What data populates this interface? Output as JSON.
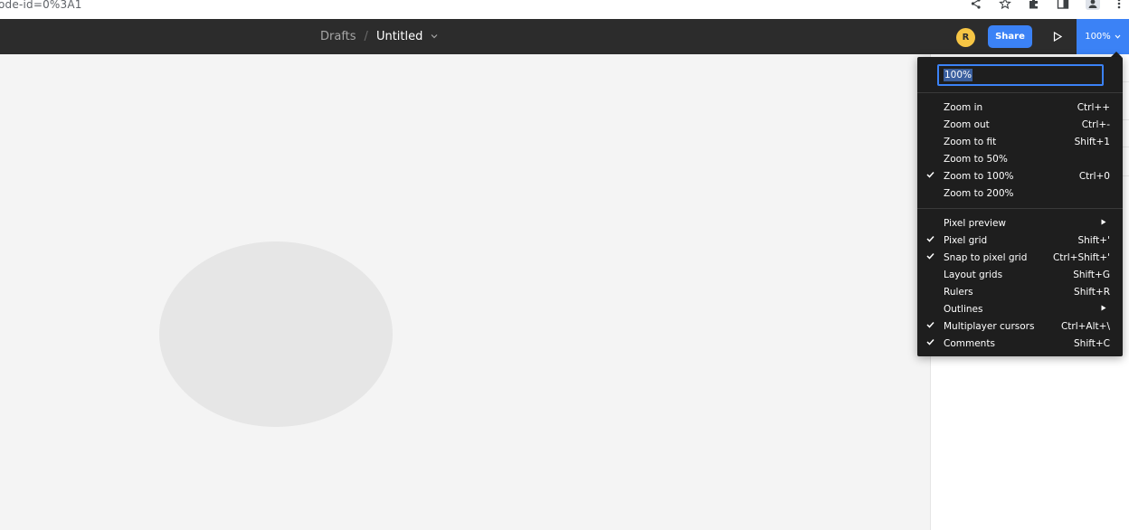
{
  "browser": {
    "url_fragment": "ode-id=0%3A1",
    "icons": [
      "share-icon",
      "star-icon",
      "extensions-icon",
      "sidepanel-icon",
      "profile-icon",
      "more-icon"
    ]
  },
  "toolbar": {
    "breadcrumb_parent": "Drafts",
    "separator": "/",
    "file_title": "Untitled",
    "avatar_initial": "R",
    "share_label": "Share",
    "zoom_label": "100%"
  },
  "menu": {
    "zoom_input_value": "100%",
    "zoom_items": [
      {
        "label": "Zoom in",
        "shortcut": "Ctrl++",
        "checked": false
      },
      {
        "label": "Zoom out",
        "shortcut": "Ctrl+-",
        "checked": false
      },
      {
        "label": "Zoom to fit",
        "shortcut": "Shift+1",
        "checked": false
      },
      {
        "label": "Zoom to 50%",
        "shortcut": "",
        "checked": false
      },
      {
        "label": "Zoom to 100%",
        "shortcut": "Ctrl+0",
        "checked": true
      },
      {
        "label": "Zoom to 200%",
        "shortcut": "",
        "checked": false
      }
    ],
    "view_items": [
      {
        "label": "Pixel preview",
        "shortcut": "",
        "submenu": true,
        "checked": false
      },
      {
        "label": "Pixel grid",
        "shortcut": "Shift+'",
        "submenu": false,
        "checked": true
      },
      {
        "label": "Snap to pixel grid",
        "shortcut": "Ctrl+Shift+'",
        "submenu": false,
        "checked": true
      },
      {
        "label": "Layout grids",
        "shortcut": "Shift+G",
        "submenu": false,
        "checked": false
      },
      {
        "label": "Rulers",
        "shortcut": "Shift+R",
        "submenu": false,
        "checked": false
      },
      {
        "label": "Outlines",
        "shortcut": "",
        "submenu": true,
        "checked": false
      },
      {
        "label": "Multiplayer cursors",
        "shortcut": "Ctrl+Alt+\\",
        "submenu": false,
        "checked": true
      },
      {
        "label": "Comments",
        "shortcut": "Shift+C",
        "submenu": false,
        "checked": true
      }
    ]
  },
  "colors": {
    "toolbar_bg": "#2c2c2c",
    "accent": "#3b82f6",
    "menu_bg": "#1e1e1e",
    "canvas_bg": "#f4f4f4",
    "shape_fill": "#e6e6e6",
    "avatar_bg": "#f6c544"
  }
}
